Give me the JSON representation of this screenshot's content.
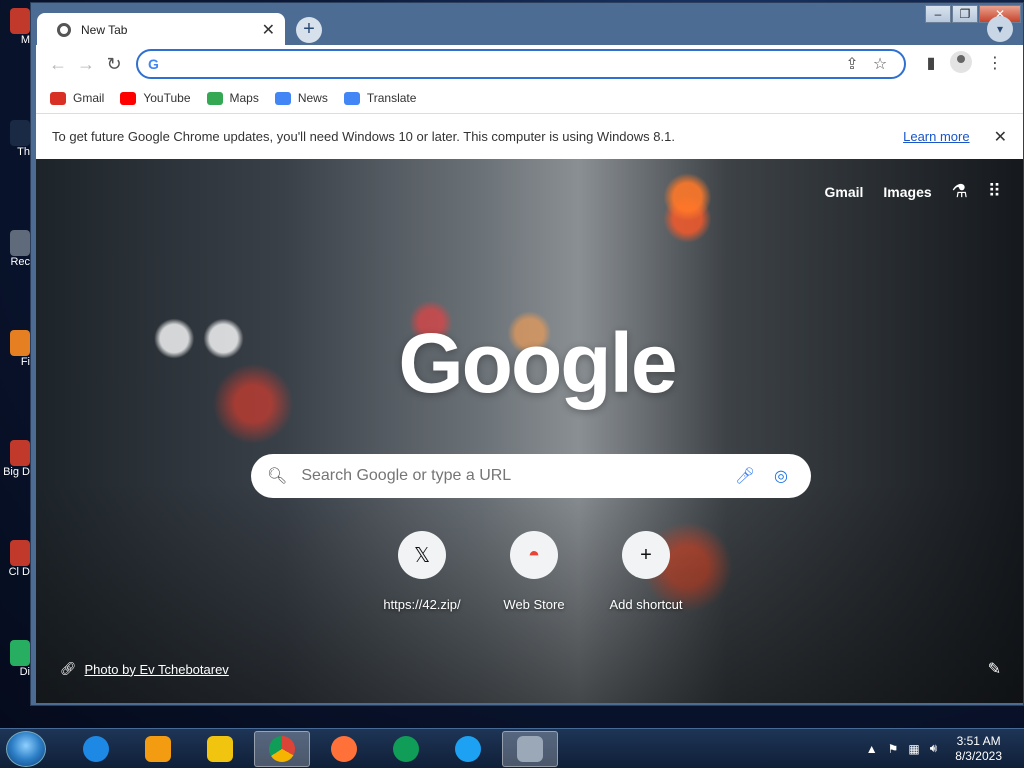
{
  "desktop": {
    "icons": [
      "M",
      "Th",
      "Rec",
      "Fi",
      "Big\nD",
      "Cl\nD",
      "Di"
    ]
  },
  "window": {
    "controls": [
      "–",
      "❐",
      "✕"
    ]
  },
  "tab": {
    "title": "New Tab",
    "close": "✕"
  },
  "toolbar": {
    "omnibox_value": "",
    "omnibox_g": "G"
  },
  "bookmarks": [
    {
      "label": "Gmail",
      "color": "#d93025"
    },
    {
      "label": "YouTube",
      "color": "#ff0000"
    },
    {
      "label": "Maps",
      "color": "#34a853"
    },
    {
      "label": "News",
      "color": "#4285f4"
    },
    {
      "label": "Translate",
      "color": "#4285f4"
    }
  ],
  "infobar": {
    "message": "To get future Google Chrome updates, you'll need Windows 10 or later. This computer is using Windows 8.1.",
    "learn_more": "Learn more",
    "close": "✕"
  },
  "ntp": {
    "links": {
      "gmail": "Gmail",
      "images": "Images"
    },
    "logo": "Google",
    "search_placeholder": "Search Google or type a URL",
    "shortcuts": [
      {
        "label": "https://42.zip/",
        "glyph": "𝕏"
      },
      {
        "label": "Web Store",
        "glyph": "◓"
      },
      {
        "label": "Add shortcut",
        "glyph": "+"
      }
    ],
    "photo_credit": "Photo by Ev Tchebotarev"
  },
  "taskbar": {
    "time": "3:51 AM",
    "date": "8/3/2023",
    "apps": [
      {
        "name": "internet-explorer",
        "color": "#1e88e5"
      },
      {
        "name": "media-player",
        "color": "#f39c12"
      },
      {
        "name": "file-explorer",
        "color": "#f1c40f"
      },
      {
        "name": "chrome",
        "color": "#db4437"
      },
      {
        "name": "firefox",
        "color": "#ff7139"
      },
      {
        "name": "sheets",
        "color": "#0f9d58"
      },
      {
        "name": "edge",
        "color": "#1da1f2"
      },
      {
        "name": "installer",
        "color": "#9aa8b8"
      }
    ]
  }
}
